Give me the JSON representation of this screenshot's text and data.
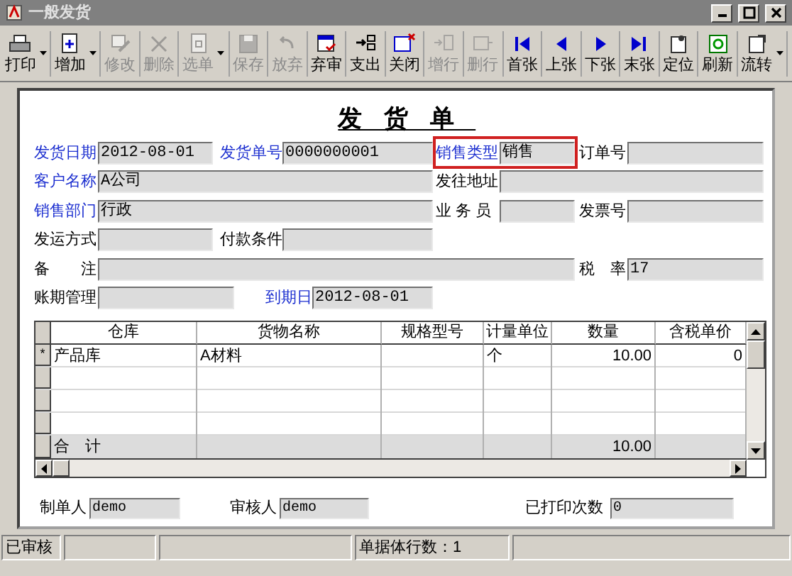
{
  "window": {
    "title": "一般发货"
  },
  "toolbar": [
    {
      "label": "打印",
      "kind": "print",
      "disabled": false,
      "dropdown": true
    },
    {
      "label": "增加",
      "kind": "add",
      "disabled": false,
      "dropdown": true
    },
    {
      "label": "修改",
      "kind": "edit",
      "disabled": true,
      "dropdown": false
    },
    {
      "label": "删除",
      "kind": "delete",
      "disabled": true,
      "dropdown": false
    },
    {
      "label": "选单",
      "kind": "select",
      "disabled": true,
      "dropdown": true
    },
    {
      "label": "保存",
      "kind": "save",
      "disabled": true,
      "dropdown": false
    },
    {
      "label": "放弃",
      "kind": "undo",
      "disabled": true,
      "dropdown": false
    },
    {
      "label": "弃审",
      "kind": "unaudit",
      "disabled": false,
      "dropdown": false
    },
    {
      "label": "支出",
      "kind": "export",
      "disabled": false,
      "dropdown": false
    },
    {
      "label": "关闭",
      "kind": "close",
      "disabled": false,
      "dropdown": false
    },
    {
      "label": "增行",
      "kind": "addrow",
      "disabled": true,
      "dropdown": false
    },
    {
      "label": "删行",
      "kind": "delrow",
      "disabled": true,
      "dropdown": false
    },
    {
      "label": "首张",
      "kind": "first",
      "disabled": false,
      "dropdown": false
    },
    {
      "label": "上张",
      "kind": "prev",
      "disabled": false,
      "dropdown": false
    },
    {
      "label": "下张",
      "kind": "next",
      "disabled": false,
      "dropdown": false
    },
    {
      "label": "末张",
      "kind": "last",
      "disabled": false,
      "dropdown": false
    },
    {
      "label": "定位",
      "kind": "locate",
      "disabled": false,
      "dropdown": false
    },
    {
      "label": "刷新",
      "kind": "refresh",
      "disabled": false,
      "dropdown": false
    },
    {
      "label": "流转",
      "kind": "flow",
      "disabled": false,
      "dropdown": true
    }
  ],
  "form": {
    "title": "发货单",
    "fields": [
      {
        "label": "发货日期",
        "value": "2012-08-01",
        "required": true,
        "highlighted": false
      },
      {
        "label": "发货单号",
        "value": "0000000001",
        "required": true,
        "highlighted": false
      },
      {
        "label": "销售类型",
        "value": "销售",
        "required": true,
        "highlighted": true
      },
      {
        "label": "订单号",
        "required": false,
        "highlighted": false
      },
      {
        "label": "客户名称",
        "value": "A公司",
        "required": true,
        "highlighted": false
      },
      {
        "label": "发往地址",
        "required": false,
        "highlighted": false
      },
      {
        "label": "销售部门",
        "value": "行政",
        "required": true,
        "highlighted": false
      },
      {
        "label": "业 务 员",
        "required": false,
        "highlighted": false
      },
      {
        "label": "发票号",
        "required": false,
        "highlighted": false
      },
      {
        "label": "发运方式",
        "required": false,
        "highlighted": false
      },
      {
        "label": "付款条件",
        "required": false,
        "highlighted": false
      },
      {
        "label": "备　　注",
        "required": false,
        "highlighted": false
      },
      {
        "label": "税　率",
        "value": "17",
        "required": false,
        "highlighted": false
      },
      {
        "label": "账期管理",
        "required": false,
        "highlighted": false
      },
      {
        "label": "到期日",
        "value": "2012-08-01",
        "required": true,
        "highlighted": false
      }
    ]
  },
  "table": {
    "columns": [
      "仓库",
      "货物名称",
      "规格型号",
      "计量单位",
      "数量",
      "含税单价"
    ],
    "rows": [
      {
        "marker": "*",
        "cells": [
          "产品库",
          "A材料",
          null,
          "个",
          "10.00",
          "0"
        ]
      },
      {
        "cells": [
          null,
          null,
          null,
          null,
          null,
          null
        ]
      },
      {
        "cells": [
          null,
          null,
          null,
          null,
          null,
          null
        ]
      },
      {
        "cells": [
          null,
          null,
          null,
          null,
          null,
          null
        ]
      }
    ],
    "total": {
      "label": "合　计",
      "cells": [
        null,
        null,
        null,
        "10.00",
        null
      ]
    }
  },
  "footer": [
    {
      "label": "制单人",
      "value": "demo"
    },
    {
      "label": "审核人",
      "value": "demo"
    },
    {
      "label": "已打印次数",
      "value": "0"
    }
  ],
  "status_bar": {
    "state": "已审核",
    "row_count": "单据体行数：1"
  }
}
